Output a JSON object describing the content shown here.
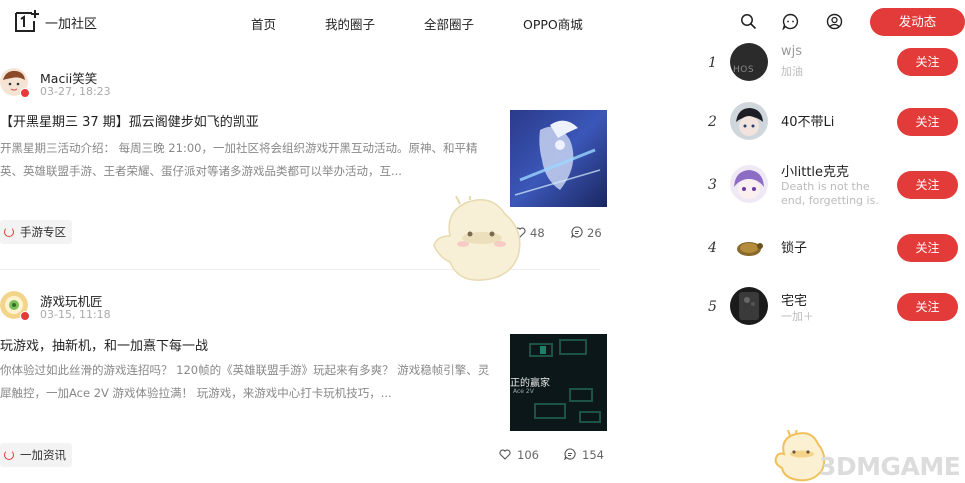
{
  "header": {
    "logo_text": "一加社区",
    "nav": [
      "首页",
      "我的圈子",
      "全部圈子",
      "OPPO商城"
    ],
    "icons": [
      "search-icon",
      "message-icon",
      "user-icon"
    ],
    "post_button": "发动态"
  },
  "posts": [
    {
      "author": "Macii笑笑",
      "date": "03-27, 18:23",
      "title": "【开黑星期三 37 期】孤云阁健步如飞的凯亚",
      "excerpt": "开黑星期三活动介绍： 每周三晚 21:00，一加社区将会组织游戏开黑互动活动。原神、和平精英、英雄联盟手游、王者荣耀、蛋仔派对等诸多游戏品类都可以举办活动，互...",
      "tag": "手游专区",
      "likes": "48",
      "comments": "26"
    },
    {
      "author": "游戏玩机匠",
      "date": "03-15, 11:18",
      "title": "玩游戏，抽新机，和一加熹下每一战",
      "excerpt": "你体验过如此丝滑的游戏连招吗？ 120帧的《英雄联盟手游》玩起来有多爽？ 游戏稳帧引擎、灵犀触控，一加Ace 2V 游戏体验拉满！ 玩游戏，来游戏中心打卡玩机技巧，...",
      "thumb_text": [
        "正的赢家",
        "Ace 2V"
      ],
      "tag": "一加资讯",
      "likes": "106",
      "comments": "154"
    }
  ],
  "ranking": [
    {
      "rank": "1",
      "name": "wjs",
      "desc": "加油",
      "avatar_text": "HOS",
      "button": "关注"
    },
    {
      "rank": "2",
      "name": "40不带Li",
      "desc": "",
      "button": "关注"
    },
    {
      "rank": "3",
      "name": "小little克克",
      "desc": "Death is not the end, forgetting is.",
      "button": "关注"
    },
    {
      "rank": "4",
      "name": "锁子",
      "desc": "",
      "button": "关注"
    },
    {
      "rank": "5",
      "name": "宅宅",
      "desc": "一加＋",
      "button": "关注"
    }
  ],
  "watermark": "3DMGAME",
  "colors": {
    "accent": "#e33a3a",
    "muted": "#888888"
  }
}
